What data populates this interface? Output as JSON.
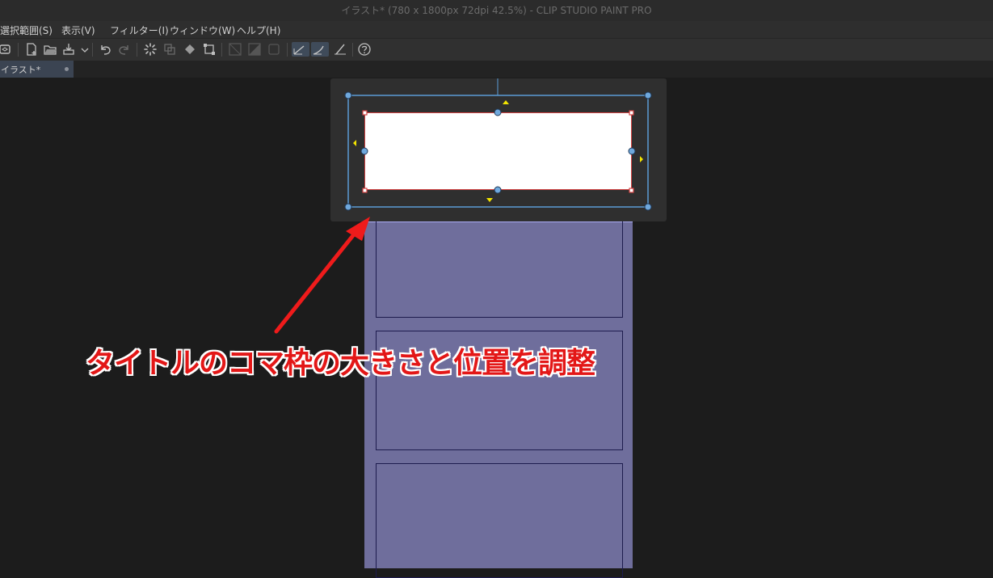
{
  "window": {
    "title": "イラスト* (780 x 1800px 72dpi 42.5%)  - CLIP STUDIO PAINT PRO"
  },
  "menu": {
    "items": [
      "選択範囲(S)",
      "表示(V)",
      "フィルター(I)",
      "ウィンドウ(W)",
      "ヘルプ(H)"
    ]
  },
  "toolbar": {
    "icons": [
      "layer-icon",
      "new-file-icon",
      "open-folder-icon",
      "save-icon",
      "dropdown-arrow-icon",
      "undo-icon",
      "redo-icon",
      "loading-spinner-icon",
      "copy-layer-icon",
      "fill-icon",
      "transform-icon",
      "frame-icon-1",
      "frame-icon-2",
      "frame-icon-3",
      "ruler-snap-icon-1",
      "ruler-snap-icon-2",
      "ruler-snap-icon-3",
      "help-icon"
    ]
  },
  "tab": {
    "label": "イラスト*"
  },
  "annotation": {
    "caption": "タイトルのコマ枠の大きさと位置を調整",
    "color": "#e31717"
  },
  "colors": {
    "accent": "#5b9bd5",
    "page": "#6f6e9c",
    "selection": "#d24242"
  }
}
